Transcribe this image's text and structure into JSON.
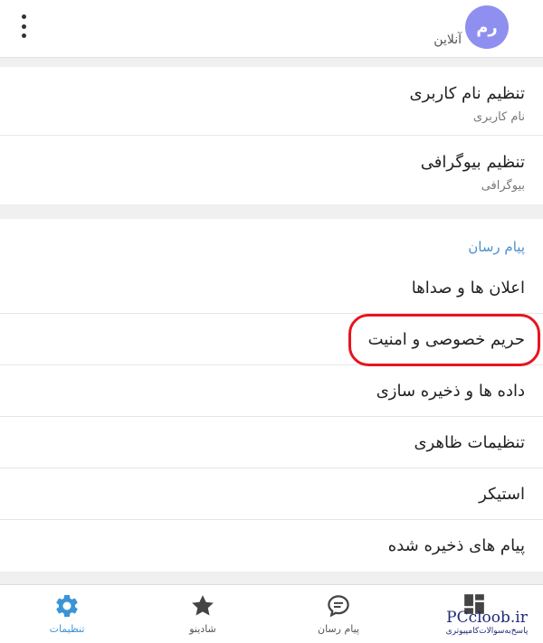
{
  "header": {
    "avatar_initials": "رم",
    "status": "آنلاین",
    "menu_icon": "more-vertical-icon"
  },
  "account": [
    {
      "title": "تنظیم نام کاربری",
      "subtitle": "نام کاربری"
    },
    {
      "title": "تنظیم بیوگرافی",
      "subtitle": "بیوگرافی"
    }
  ],
  "messenger": {
    "section_title": "پیام رسان",
    "items": [
      "اعلان ها و صداها",
      "حریم خصوصی و امنیت",
      "داده ها و ذخیره سازی",
      "تنظیمات ظاهری",
      "استیکر",
      "پیام های ذخیره شده"
    ]
  },
  "bottom_nav": {
    "items": [
      {
        "label": "تنظیمات",
        "icon": "gear-icon",
        "active": true
      },
      {
        "label": "شادینو",
        "icon": "star-icon",
        "active": false
      },
      {
        "label": "پیام رسان",
        "icon": "chat-bubble-icon",
        "active": false
      },
      {
        "label": "",
        "icon": "grid-icon",
        "active": false
      }
    ]
  },
  "watermark": {
    "site": "PCcloob.ir",
    "tagline": "پاسخ‌به‌سوالات‌کامپیوتری"
  },
  "colors": {
    "accent": "#3a94d6",
    "section_title": "#4a8fd0",
    "avatar": "#8f8ff0",
    "highlight": "#e8141e"
  }
}
